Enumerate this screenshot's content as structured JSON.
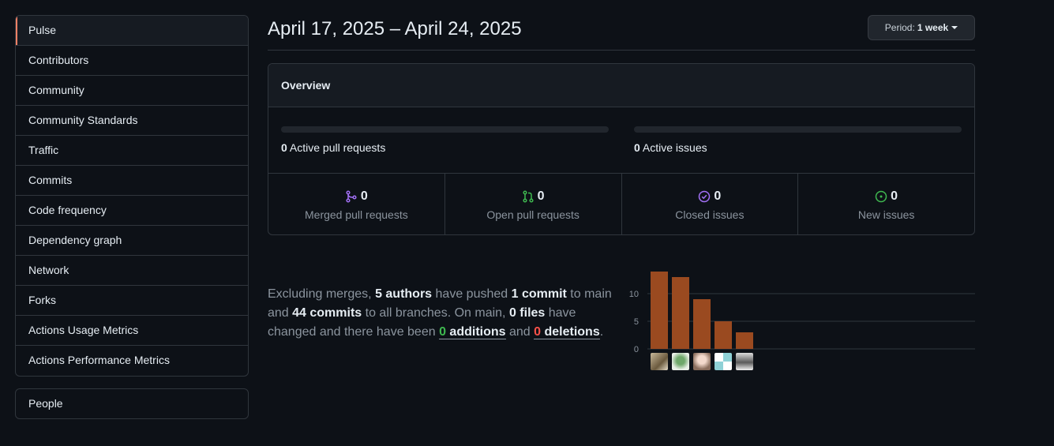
{
  "sidebar": {
    "items": [
      {
        "label": "Pulse",
        "selected": true
      },
      {
        "label": "Contributors"
      },
      {
        "label": "Community"
      },
      {
        "label": "Community Standards"
      },
      {
        "label": "Traffic"
      },
      {
        "label": "Commits"
      },
      {
        "label": "Code frequency"
      },
      {
        "label": "Dependency graph"
      },
      {
        "label": "Network"
      },
      {
        "label": "Forks"
      },
      {
        "label": "Actions Usage Metrics"
      },
      {
        "label": "Actions Performance Metrics"
      }
    ],
    "secondary": [
      {
        "label": "People"
      }
    ]
  },
  "header": {
    "date_range": "April 17, 2025 – April 24, 2025",
    "period_prefix": "Period:",
    "period_value": "1 week"
  },
  "overview": {
    "title": "Overview",
    "active_prs_count": "0",
    "active_prs_label": "Active pull requests",
    "active_issues_count": "0",
    "active_issues_label": "Active issues",
    "stats": [
      {
        "count": "0",
        "label": "Merged pull requests",
        "icon": "merge-icon",
        "color": "#a371f7"
      },
      {
        "count": "0",
        "label": "Open pull requests",
        "icon": "pull-request-icon",
        "color": "#3fb950"
      },
      {
        "count": "0",
        "label": "Closed issues",
        "icon": "issue-closed-icon",
        "color": "#a371f7"
      },
      {
        "count": "0",
        "label": "New issues",
        "icon": "issue-opened-icon",
        "color": "#3fb950"
      }
    ]
  },
  "commit_summary": {
    "t1": "Excluding merges, ",
    "authors": "5 authors",
    "t2": " have pushed ",
    "commits_main": "1 commit",
    "t3": " to main and ",
    "commits_all": "44 commits",
    "t4": " to all branches. On main, ",
    "files": "0 files",
    "t5": " have changed and there have been ",
    "additions_count": "0",
    "additions_label": " additions",
    "t6": " and ",
    "deletions_count": "0",
    "deletions_label": " deletions",
    "t7": "."
  },
  "chart_data": {
    "type": "bar",
    "values": [
      14,
      13,
      9,
      5,
      3
    ],
    "y_ticks": [
      "0",
      "5",
      "10"
    ],
    "ylim": [
      0,
      15
    ],
    "bar_color": "#9a4a20",
    "grid": true
  }
}
